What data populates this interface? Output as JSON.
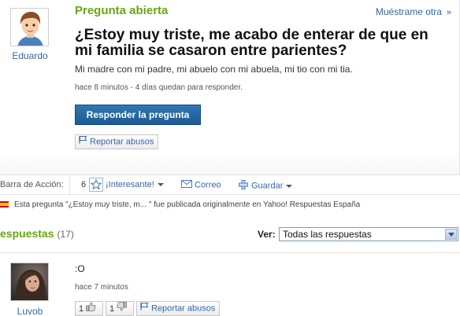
{
  "question": {
    "status": "Pregunta abierta",
    "show_other": "Muéstrame otra",
    "show_other_arrow": "»",
    "asker_name": "Eduardo",
    "title": "¿Estoy muy triste, me acabo de enterar de que en mi familia se casaron entre parientes?",
    "body": "Mi madre con mi padre, mi abuelo con mi abuela, mi tio con mi tia.",
    "meta": "hace 8 minutos - 4 días quedan para responder.",
    "answer_button": "Responder la pregunta",
    "report_label": "Reportar abusos"
  },
  "action_bar": {
    "label": "Barra de Acción:",
    "interest_count": "6",
    "interesting_label": "¡Interesante!",
    "mail_label": "Correo",
    "save_label": "Guardar"
  },
  "origin_note": "Esta pregunta \"¿Estoy muy triste, m... \" fue publicada originalmente en Yahoo! Respuestas España",
  "answers": {
    "title": "espuestas",
    "count": "(17)",
    "view_label": "Ver:",
    "view_selected": "Todas las respuestas",
    "items": [
      {
        "author": "Luvob",
        "text": ":O",
        "time": "hace 7 minutos",
        "thumbs_up": "1",
        "thumbs_down": "1",
        "report_label": "Reportar abusos"
      }
    ]
  },
  "colors": {
    "green_title": "#6aa514",
    "link_blue": "#3366aa",
    "button_blue": "#1d5a93"
  }
}
